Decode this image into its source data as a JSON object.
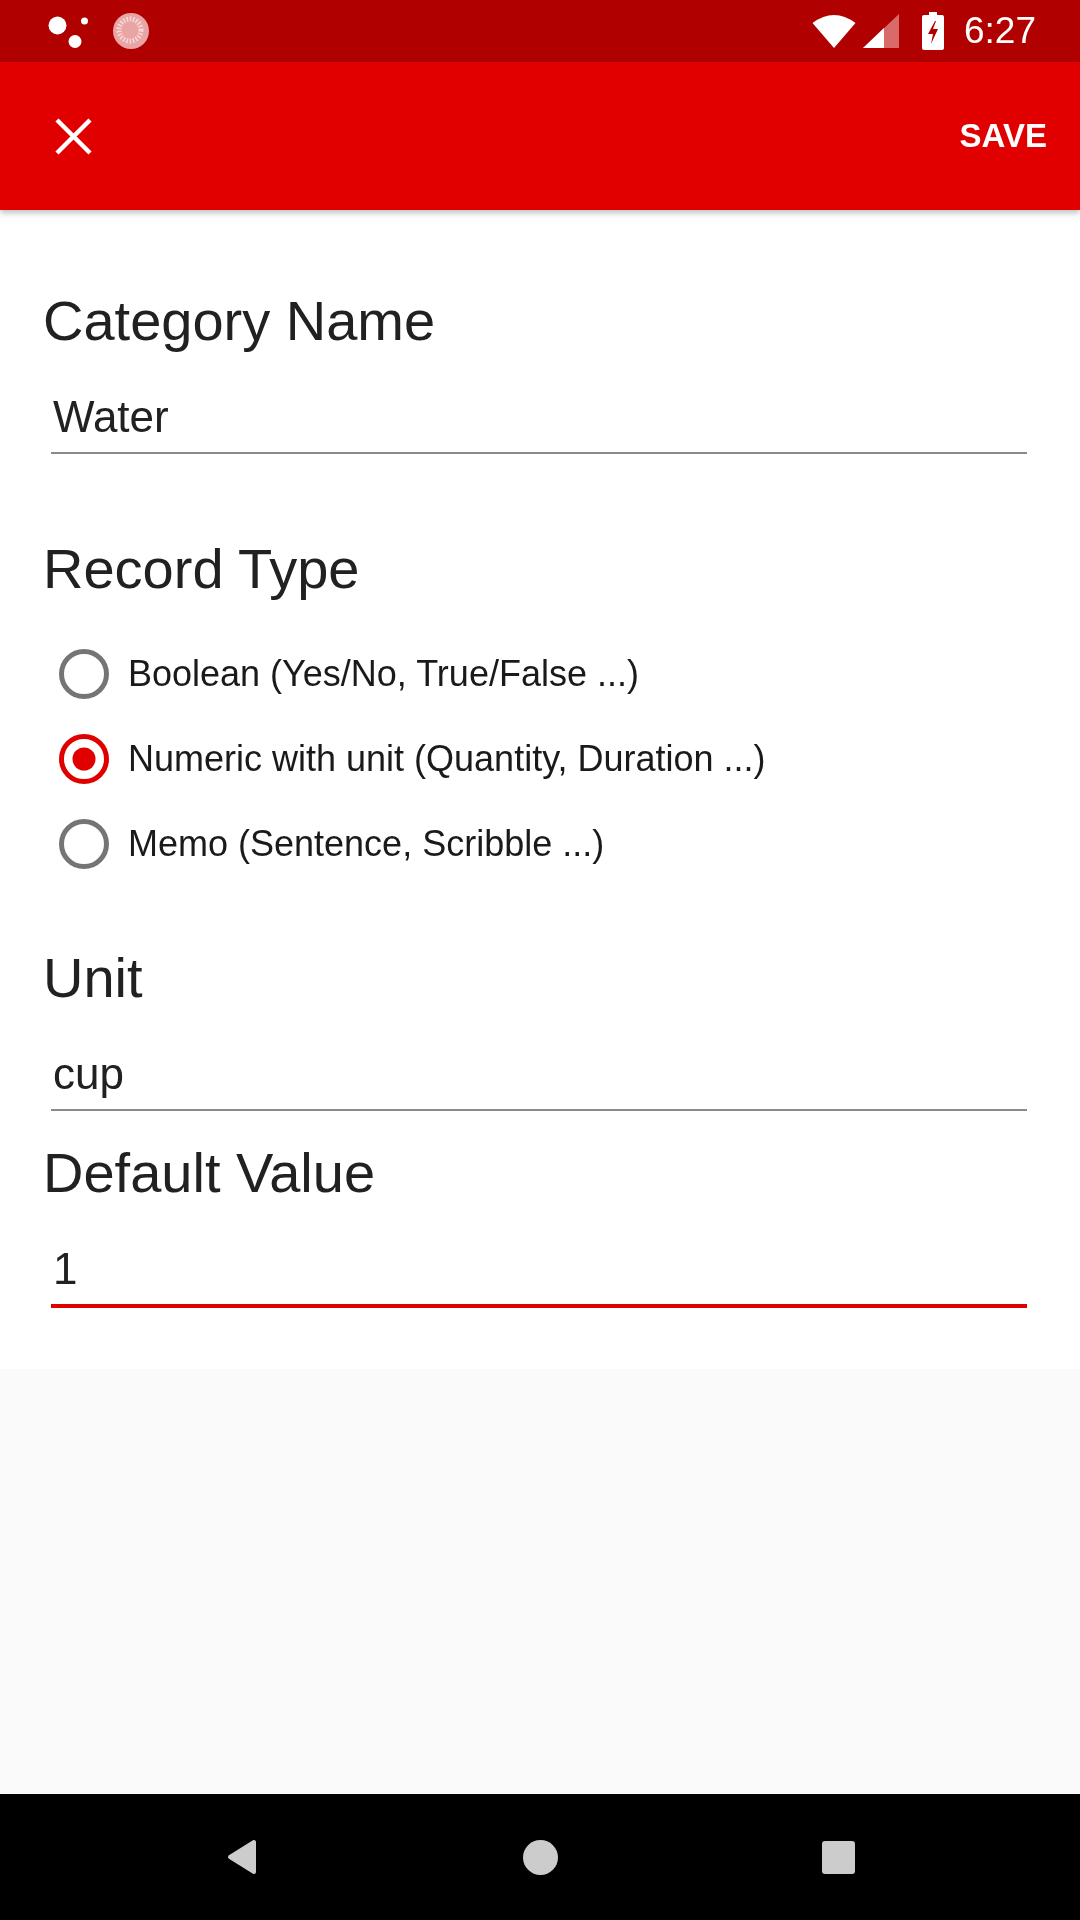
{
  "status_bar": {
    "time": "6:27"
  },
  "app_bar": {
    "action": "SAVE"
  },
  "sections": [
    {
      "kind": "text_field",
      "label": "Category Name",
      "value": "Water",
      "focused": false
    },
    {
      "kind": "radio_group",
      "label": "Record Type",
      "options": [
        {
          "label": "Boolean (Yes/No, True/False ...)",
          "selected": false
        },
        {
          "label": "Numeric with unit (Quantity, Duration ...)",
          "selected": true
        },
        {
          "label": "Memo (Sentence, Scribble ...)",
          "selected": false
        }
      ]
    },
    {
      "kind": "text_field",
      "label": "Unit",
      "value": "cup",
      "focused": false
    },
    {
      "kind": "text_field",
      "label": "Default Value",
      "value": "1",
      "focused": true
    }
  ]
}
